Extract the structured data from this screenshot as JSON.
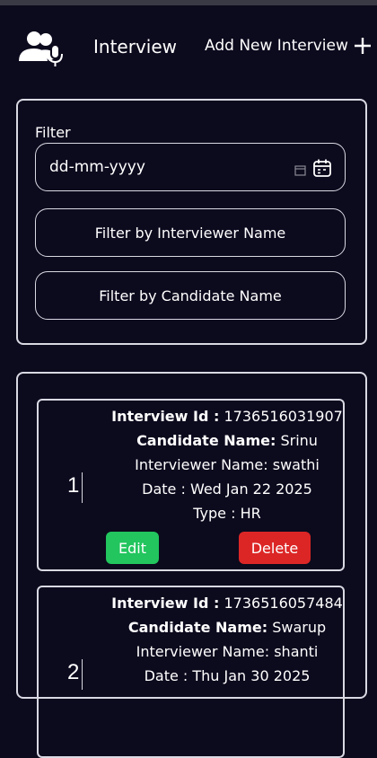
{
  "navbar": {
    "brand": "Interview",
    "add_link": "Add New Interview",
    "logo_icon": "users-microphone-icon",
    "add_icon": "plus-icon"
  },
  "filter": {
    "label": "Filter",
    "date_placeholder": "dd-mm-yyyy",
    "interviewer_placeholder": "Filter by Interviewer Name",
    "candidate_placeholder": "Filter by Candidate Name"
  },
  "labels": {
    "interview_id": "Interview Id :",
    "candidate_name": "Candidate Name:",
    "interviewer_name": "Interviewer Name:",
    "date": "Date :",
    "type": "Type :",
    "edit": "Edit",
    "delete": "Delete"
  },
  "interviews": [
    {
      "index": "1",
      "id": "1736516031907",
      "candidate": "Srinu",
      "interviewer": "swathi",
      "date": "Wed Jan 22 2025",
      "type": "HR"
    },
    {
      "index": "2",
      "id": "1736516057484",
      "candidate": "Swarup",
      "interviewer": "shanti",
      "date": "Thu Jan 30 2025",
      "type": ""
    }
  ],
  "colors": {
    "background": "#0c0a1d",
    "border": "#d9d9e3",
    "edit": "#22c55e",
    "delete": "#dc2626"
  }
}
